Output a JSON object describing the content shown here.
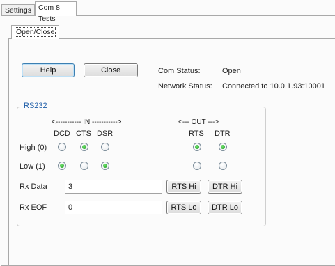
{
  "outer_tabs": [
    "Settings",
    "Com 8 Tests"
  ],
  "inner_tab": "Open/Close",
  "buttons": {
    "help": "Help",
    "close": "Close"
  },
  "status": {
    "com_label": "Com Status:",
    "com_value": "Open",
    "network_label": "Network Status:",
    "network_value": "Connected to 10.0.1.93:10001"
  },
  "rs232": {
    "title": "RS232",
    "in_header": "<----------- IN ----------->",
    "out_header": "<--- OUT --->",
    "columns_in": [
      "DCD",
      "CTS",
      "DSR"
    ],
    "columns_out": [
      "RTS",
      "DTR"
    ],
    "row_labels": [
      "High (0)",
      "Low (1)"
    ],
    "high_checked": [
      false,
      true,
      false,
      true,
      true
    ],
    "low_checked": [
      true,
      false,
      true,
      false,
      false
    ],
    "rx_data_label": "Rx Data",
    "rx_data_value": "3",
    "rx_eof_label": "Rx EOF",
    "rx_eof_value": "0",
    "rts_hi": "RTS Hi",
    "dtr_hi": "DTR Hi",
    "rts_lo": "RTS Lo",
    "dtr_lo": "DTR Lo"
  }
}
